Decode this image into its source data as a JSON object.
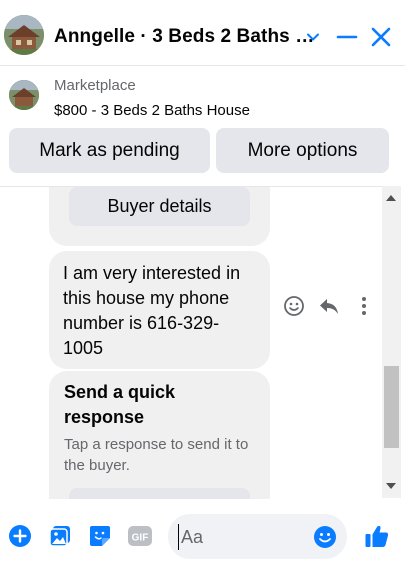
{
  "header": {
    "title": "Anngelle · 3 Beds 2 Baths …",
    "icons": [
      "chevron-down-icon",
      "minimize-icon",
      "close-icon"
    ]
  },
  "marketplace": {
    "label": "Marketplace",
    "listing": "$800 - 3 Beds 2 Baths House",
    "buttons": {
      "mark_pending": "Mark as pending",
      "more_options": "More options"
    }
  },
  "messages": {
    "buyer_details_label": "Buyer details",
    "message_text": "I am very interested in this house my phone number is 616-329-1005",
    "quick_response": {
      "title": "Send a quick response",
      "subtitle": "Tap a response to send it to the buyer."
    }
  },
  "composer": {
    "placeholder": "Aa",
    "icons": [
      "plus-icon",
      "photo-icon",
      "sticker-icon",
      "gif-icon",
      "emoji-icon",
      "thumbs-up-icon"
    ]
  },
  "colors": {
    "accent": "#0a7cff",
    "bubble": "#f0f0f0",
    "button": "#e4e6eb",
    "secondary_text": "#65676b"
  }
}
